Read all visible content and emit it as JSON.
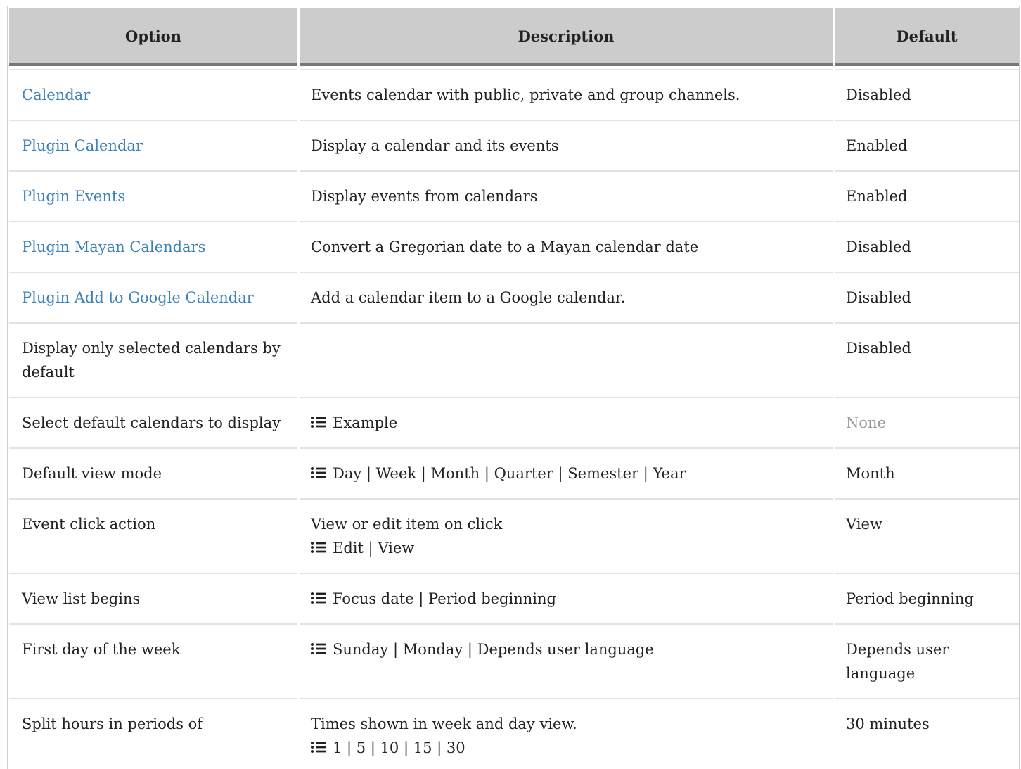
{
  "table": {
    "headers": {
      "option": "Option",
      "description": "Description",
      "default": "Default"
    },
    "rows": [
      {
        "option": "Calendar",
        "option_is_link": true,
        "description": "Events calendar with public, private and group channels.",
        "default": "Disabled"
      },
      {
        "option": "Plugin Calendar",
        "option_is_link": true,
        "description": "Display a calendar and its events",
        "default": "Enabled"
      },
      {
        "option": "Plugin Events",
        "option_is_link": true,
        "description": "Display events from calendars",
        "default": "Enabled"
      },
      {
        "option": "Plugin Mayan Calendars",
        "option_is_link": true,
        "description": "Convert a Gregorian date to a Mayan calendar date",
        "default": "Disabled"
      },
      {
        "option": "Plugin Add to Google Calendar",
        "option_is_link": true,
        "description": "Add a calendar item to a Google calendar.",
        "default": "Disabled"
      },
      {
        "option": "Display only selected calendars by default",
        "option_is_link": false,
        "description": "",
        "default": "Disabled"
      },
      {
        "option": "Select default calendars to display",
        "option_is_link": false,
        "description_list": "Example",
        "default": "None",
        "default_muted": true
      },
      {
        "option": "Default view mode",
        "option_is_link": false,
        "description_list": "Day | Week | Month | Quarter | Semester | Year",
        "default": "Month"
      },
      {
        "option": "Event click action",
        "option_is_link": false,
        "description": "View or edit item on click",
        "description_list": "Edit | View",
        "default": "View"
      },
      {
        "option": "View list begins",
        "option_is_link": false,
        "description_list": "Focus date | Period beginning",
        "default": "Period beginning"
      },
      {
        "option": "First day of the week",
        "option_is_link": false,
        "description_list": "Sunday | Monday | Depends user language",
        "default": "Depends user language"
      },
      {
        "option": "Split hours in periods of",
        "option_is_link": false,
        "description": "Times shown in week and day view.",
        "description_list": "1 | 5 | 10 | 15 | 30",
        "default": "30 minutes"
      }
    ]
  },
  "icons": {
    "options_list": "list-icon"
  },
  "colors": {
    "link": "#3d82b8",
    "header_bg": "#cccccc",
    "muted": "#999999"
  }
}
